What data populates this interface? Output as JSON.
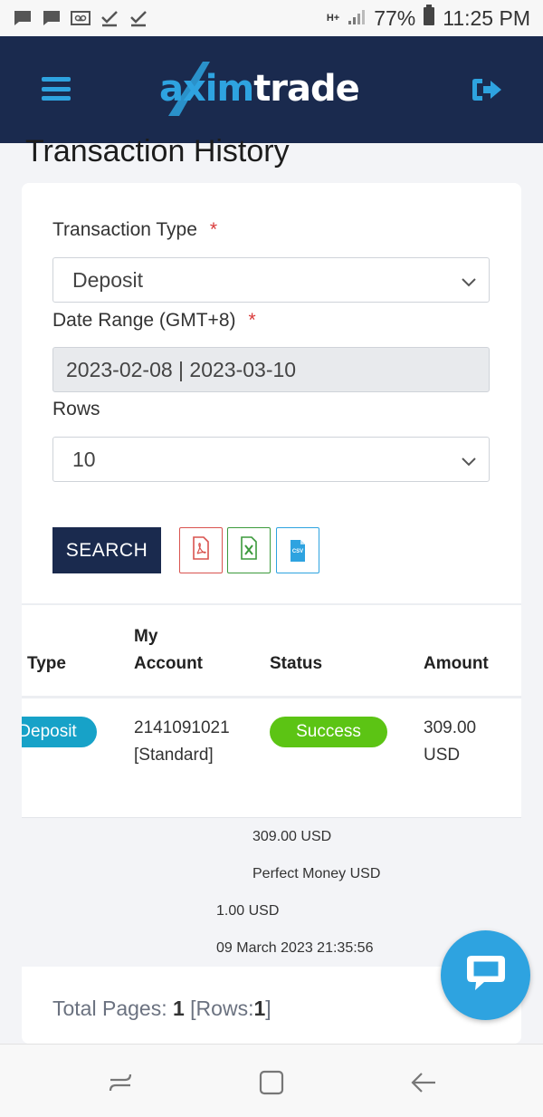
{
  "status_bar": {
    "battery": "77%",
    "time": "11:25 PM",
    "network": "H+"
  },
  "header": {
    "logo_part1": "axim",
    "logo_part2": "trade",
    "menu_icon": "hamburger-menu-icon",
    "logout_icon": "logout-icon"
  },
  "page": {
    "title": "Transaction History"
  },
  "form": {
    "transaction_type_label": "Transaction Type",
    "transaction_type_value": "Deposit",
    "date_range_label": "Date Range (GMT+8)",
    "date_range_value": "2023-02-08 | 2023-03-10",
    "rows_label": "Rows",
    "rows_value": "10",
    "required_mark": "*",
    "search_label": "SEARCH",
    "export_csv_text": "csv"
  },
  "table": {
    "headers": {
      "type": "Type",
      "account_line1": "My",
      "account_line2": "Account",
      "status": "Status",
      "amount": "Amount"
    },
    "row": {
      "type": "Deposit",
      "account_line1": "2141091021",
      "account_line2": "[Standard]",
      "status": "Success",
      "amount_line1": "309.00",
      "amount_line2": "USD"
    },
    "details": {
      "amount": "309.00 USD",
      "method": "Perfect Money USD",
      "fee": "1.00 USD",
      "datetime": "09 March 2023 21:35:56"
    }
  },
  "pagination": {
    "label": "Total Pages:",
    "pages": "1",
    "rows_prefix": "[Rows:",
    "rows": "1",
    "rows_suffix": "]"
  },
  "colors": {
    "navy": "#1a2a4e",
    "brand_blue": "#2ea3e0",
    "success_green": "#5cc414",
    "deposit_teal": "#17a2c8",
    "pdf_red": "#d9534f",
    "excel_green": "#3c9a3c",
    "csv_blue": "#2ea3e0"
  }
}
